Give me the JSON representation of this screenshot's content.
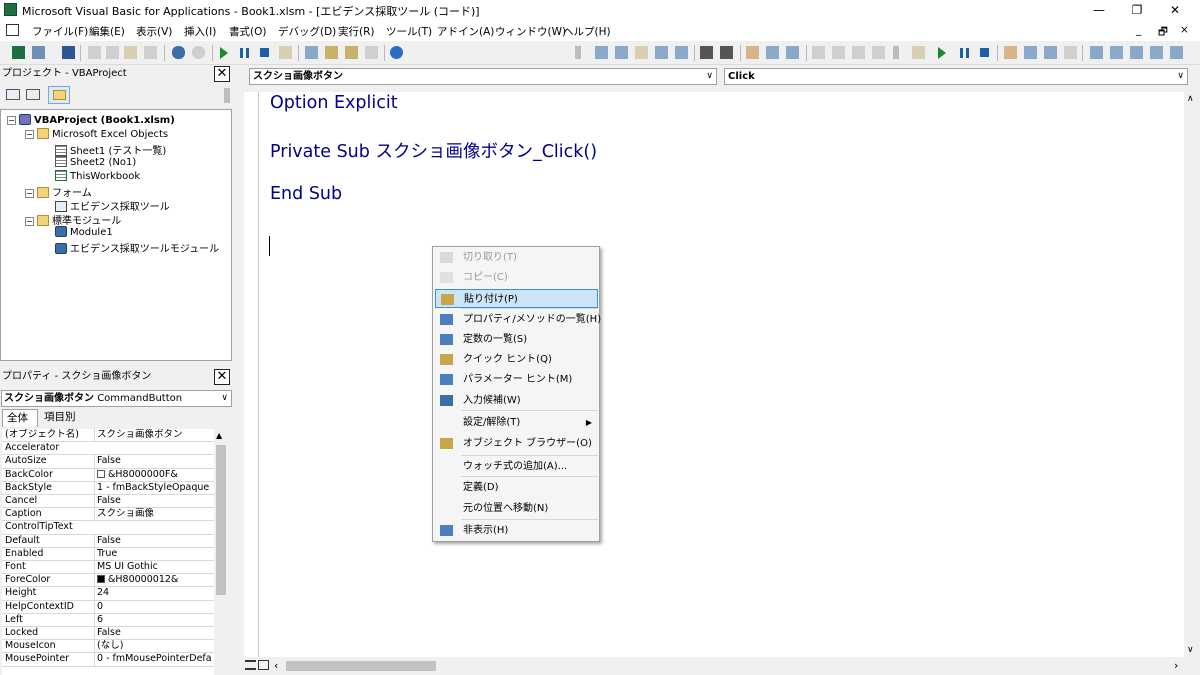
{
  "window": {
    "title": "Microsoft Visual Basic for Applications - Book1.xlsm - [エビデンス採取ツール (コード)]",
    "minimize_glyph": "—",
    "restore_glyph": "❐",
    "close_glyph": "✕"
  },
  "menu": {
    "items": [
      "ファイル(F)",
      "編集(E)",
      "表示(V)",
      "挿入(I)",
      "書式(O)",
      "デバッグ(D)",
      "実行(R)",
      "ツール(T)",
      "アドイン(A)",
      "ウィンドウ(W)",
      "ヘルプ(H)"
    ],
    "right_glyphs": [
      "_",
      "🗗",
      "×"
    ]
  },
  "project_pane": {
    "title": "プロジェクト - VBAProject",
    "close": "✕",
    "tree": [
      {
        "label": "VBAProject (Book1.xlsm)",
        "icon": "vbaproject-icon",
        "level": 0,
        "expander": "−"
      },
      {
        "label": "Microsoft Excel Objects",
        "icon": "folder-icon",
        "level": 1,
        "expander": "−"
      },
      {
        "label": "Sheet1 (テスト一覧)",
        "icon": "sheet-icon",
        "level": 2
      },
      {
        "label": "Sheet2 (No1)",
        "icon": "sheet-icon",
        "level": 2
      },
      {
        "label": "ThisWorkbook",
        "icon": "workbook-icon",
        "level": 2
      },
      {
        "label": "フォーム",
        "icon": "folder-icon",
        "level": 1,
        "expander": "−"
      },
      {
        "label": "エビデンス採取ツール",
        "icon": "userform-icon",
        "level": 2
      },
      {
        "label": "標準モジュール",
        "icon": "folder-icon",
        "level": 1,
        "expander": "−"
      },
      {
        "label": "Module1",
        "icon": "module-icon",
        "level": 2
      },
      {
        "label": "エビデンス採取ツールモジュール",
        "icon": "module-icon",
        "level": 2
      }
    ]
  },
  "properties_pane": {
    "title": "プロパティ - スクショ画像ボタン",
    "close": "✕",
    "object_bold": "スクショ画像ボタン",
    "object_type": "CommandButton",
    "tabs": [
      "全体",
      "項目別"
    ],
    "rows": [
      {
        "name": "(オブジェクト名)",
        "value": "スクショ画像ボタン"
      },
      {
        "name": "Accelerator",
        "value": ""
      },
      {
        "name": "AutoSize",
        "value": "False"
      },
      {
        "name": "BackColor",
        "value": "&H8000000F&",
        "swatch": "#ffffff"
      },
      {
        "name": "BackStyle",
        "value": "1 - fmBackStyleOpaque"
      },
      {
        "name": "Cancel",
        "value": "False"
      },
      {
        "name": "Caption",
        "value": "スクショ画像"
      },
      {
        "name": "ControlTipText",
        "value": ""
      },
      {
        "name": "Default",
        "value": "False"
      },
      {
        "name": "Enabled",
        "value": "True"
      },
      {
        "name": "Font",
        "value": "MS UI Gothic"
      },
      {
        "name": "ForeColor",
        "value": "&H80000012&",
        "swatch": "#000000"
      },
      {
        "name": "Height",
        "value": "24"
      },
      {
        "name": "HelpContextID",
        "value": "0"
      },
      {
        "name": "Left",
        "value": "6"
      },
      {
        "name": "Locked",
        "value": "False"
      },
      {
        "name": "MouseIcon",
        "value": "(なし)"
      },
      {
        "name": "MousePointer",
        "value": "0 - fmMousePointerDefau"
      }
    ]
  },
  "code_window": {
    "object_combo": "スクショ画像ボタン",
    "procedure_combo": "Click",
    "lines": [
      "Option Explicit",
      "Private Sub スクショ画像ボタン_Click()",
      "End Sub"
    ]
  },
  "context_menu": {
    "items": [
      {
        "label": "切り取り(T)",
        "icon": "cut-icon",
        "disabled": true
      },
      {
        "label": "コピー(C)",
        "icon": "copy-icon",
        "disabled": true
      },
      {
        "label": "貼り付け(P)",
        "icon": "paste-icon",
        "highlighted": true
      },
      {
        "label": "プロパティ/メソッドの一覧(H)",
        "icon": "list-members-icon"
      },
      {
        "label": "定数の一覧(S)",
        "icon": "list-constants-icon"
      },
      {
        "label": "クイック ヒント(Q)",
        "icon": "quick-info-icon"
      },
      {
        "label": "パラメーター ヒント(M)",
        "icon": "parameter-info-icon"
      },
      {
        "label": "入力候補(W)",
        "icon": "complete-word-icon"
      },
      {
        "label": "設定/解除(T)",
        "icon": "",
        "submenu": true
      },
      {
        "label": "オブジェクト ブラウザー(O)",
        "icon": "object-browser-icon"
      },
      {
        "label": "ウォッチ式の追加(A)...",
        "icon": ""
      },
      {
        "label": "定義(D)",
        "icon": ""
      },
      {
        "label": "元の位置へ移動(N)",
        "icon": ""
      },
      {
        "label": "非表示(H)",
        "icon": "hide-icon"
      }
    ]
  }
}
